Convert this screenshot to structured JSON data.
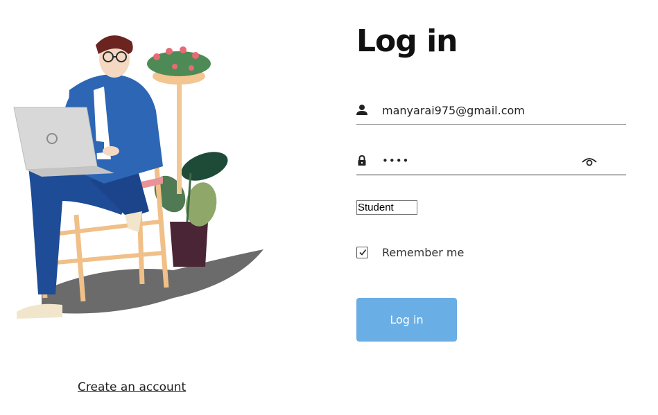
{
  "login_form": {
    "title": "Log in",
    "email": {
      "value": "manyarai975@gmail.com",
      "icon": "user-icon"
    },
    "password": {
      "value": "••••",
      "icon": "lock-icon",
      "toggle_icon": "eye-icon"
    },
    "role_select": {
      "selected": "Student"
    },
    "remember_me": {
      "label": "Remember me",
      "checked": true
    },
    "submit_label": "Log in",
    "submit_color": "#6aaee6"
  },
  "create_account_link": "Create an account",
  "illustration": {
    "subject": "person-with-laptop-on-chair-illustration"
  }
}
